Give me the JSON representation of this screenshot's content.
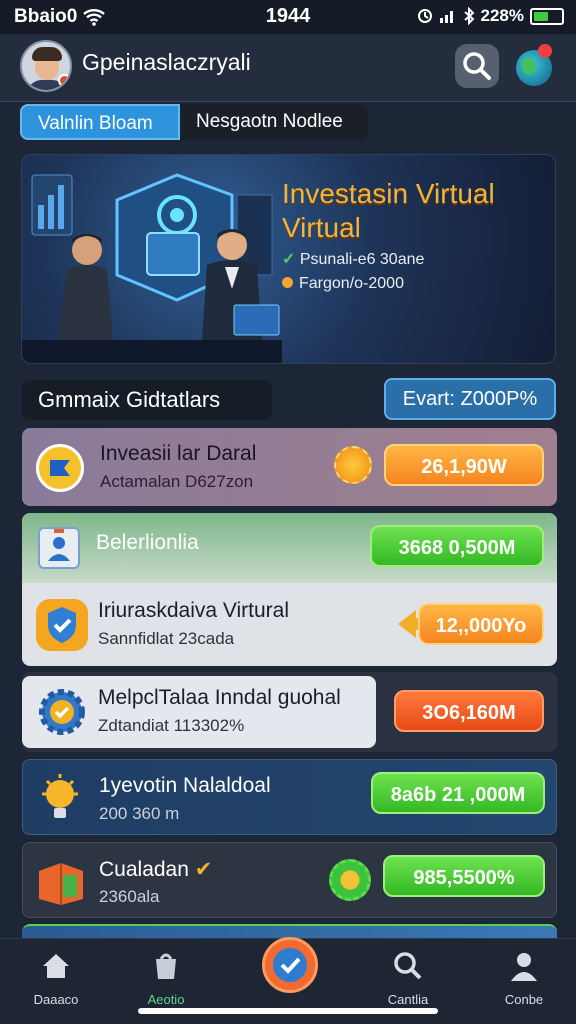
{
  "status_bar": {
    "carrier": "Bbaio0",
    "time": "1944",
    "battery": "228%"
  },
  "header": {
    "username": "Gpeinaslaczryali"
  },
  "tabs": [
    {
      "label": "Valnlin Bloam",
      "active": true
    },
    {
      "label": "Nesgaotn Nodlee",
      "active": false
    }
  ],
  "hero": {
    "title_line1": "Investasin Virtual",
    "title_line2": "Virtual",
    "line1": "Psunali-e6 30ane",
    "line2": "Fargon/o-2000",
    "accent_color": "#f2b43c"
  },
  "section": {
    "title": "Gmmaix Gidtatlars",
    "events_button": "Evart: Z000P%"
  },
  "cards": [
    {
      "title": "Inveasii lar Daral",
      "subtitle": "Actamalan D627zon",
      "amount": "26,1,90W",
      "pill_color": "orange",
      "icon": "ticket-icon"
    },
    {
      "title": "Belerlionlia",
      "subtitle": "",
      "amount": "3668 0,500M",
      "pill_color": "green",
      "icon": "person-card-icon"
    },
    {
      "title": "Iriuraskdaiva Virtural",
      "subtitle": "Sannfidlat 23cada",
      "amount": "12,,000Yo",
      "pill_color": "orange",
      "icon": "shield-check-icon"
    },
    {
      "title": "MelpclTalaa Inndal guohal",
      "subtitle": "Zdtandiat 113302%",
      "amount": "3O6,160M",
      "pill_color": "red",
      "icon": "gear-check-icon"
    },
    {
      "title": "1yevotin Nalaldoal",
      "subtitle": "200 360 m",
      "amount": "8a6b 21 ,000M",
      "pill_color": "green",
      "icon": "lightbulb-icon"
    },
    {
      "title": "Cualadan",
      "subtitle": "2360ala",
      "amount": "985,5500%",
      "pill_color": "green",
      "icon": "box-icon"
    }
  ],
  "bottom_nav": [
    {
      "label": "Daaaco",
      "icon": "home-icon"
    },
    {
      "label": "Aeotio",
      "icon": "bag-icon"
    },
    {
      "label": "",
      "icon": "check-badge-icon"
    },
    {
      "label": "Cantlia",
      "icon": "search-icon"
    },
    {
      "label": "Conbe",
      "icon": "profile-icon"
    }
  ]
}
